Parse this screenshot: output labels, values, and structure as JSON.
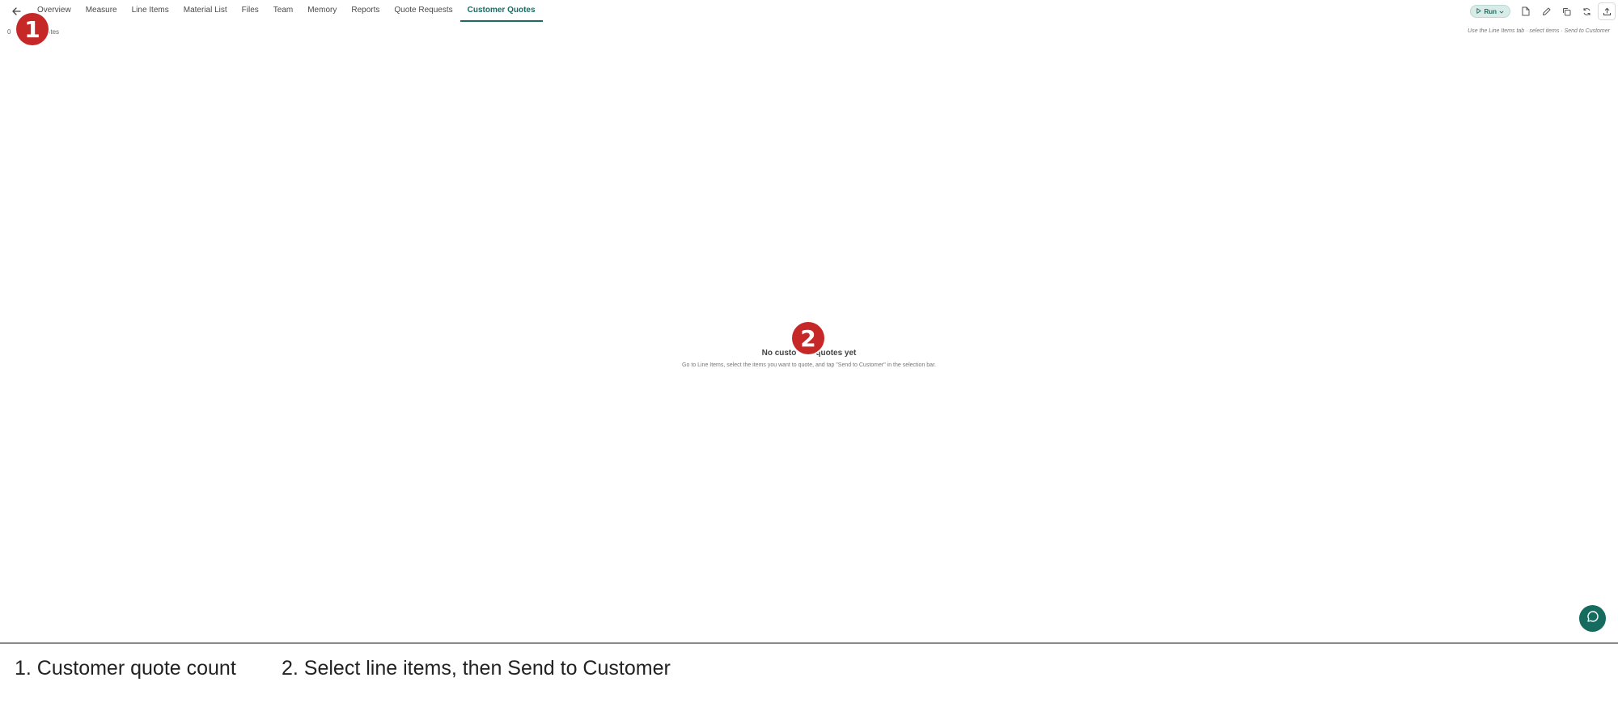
{
  "tabs": [
    {
      "label": "Overview",
      "active": false
    },
    {
      "label": "Measure",
      "active": false
    },
    {
      "label": "Line Items",
      "active": false
    },
    {
      "label": "Material List",
      "active": false
    },
    {
      "label": "Files",
      "active": false
    },
    {
      "label": "Team",
      "active": false
    },
    {
      "label": "Memory",
      "active": false
    },
    {
      "label": "Reports",
      "active": false
    },
    {
      "label": "Quote Requests",
      "active": false
    },
    {
      "label": "Customer Quotes",
      "active": true
    }
  ],
  "toolbar": {
    "run_label": "Run",
    "icons": [
      "document-icon",
      "edit-icon",
      "copy-icon",
      "refresh-icon",
      "upload-icon"
    ]
  },
  "subbar": {
    "count_prefix": "0",
    "count_suffix": "uotes",
    "hint": "Use the Line Items tab · select items · Send to Customer"
  },
  "empty_state": {
    "title_left": "No custo",
    "title_right": "quotes yet",
    "description": "Go to Line Items, select the items you want to quote, and tap \"Send to Customer\" in the selection bar."
  },
  "markers": [
    "1",
    "2"
  ],
  "legend": {
    "item1": "1. Customer quote count",
    "item2": "2. Select line items, then Send to Customer"
  },
  "colors": {
    "accent": "#1e6b63",
    "marker": "#c62828",
    "chat_button": "#166b5f"
  }
}
